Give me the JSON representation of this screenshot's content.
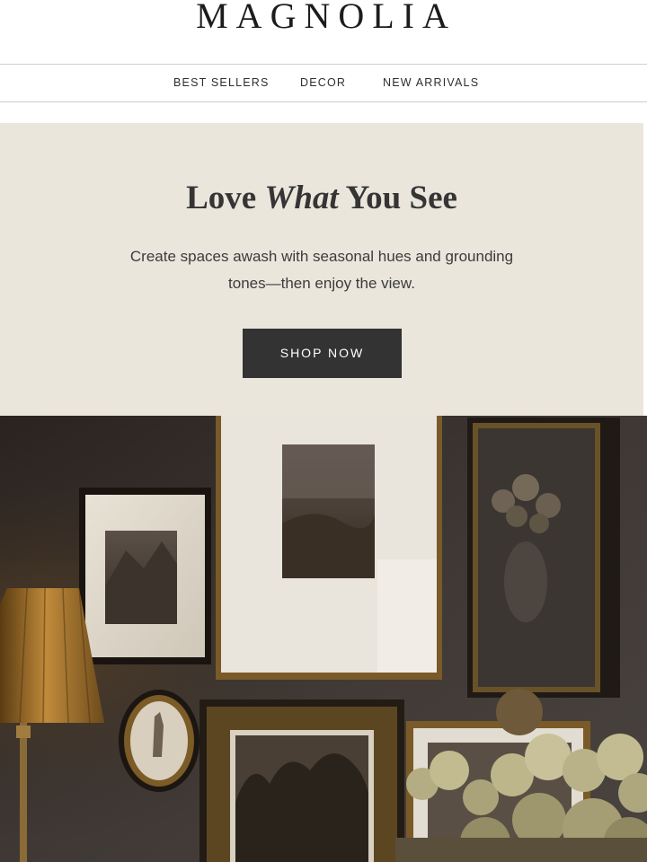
{
  "brand": {
    "name": "MAGNOLIA"
  },
  "nav": {
    "items": [
      {
        "label": "BEST SELLERS"
      },
      {
        "label": "DECOR"
      },
      {
        "label": "NEW ARRIVALS"
      }
    ]
  },
  "hero": {
    "title_pre": "Love ",
    "title_em": "What",
    "title_post": " You See",
    "subtitle_line1": "Create spaces awash with seasonal hues and grounding",
    "subtitle_line2": "tones—then enjoy the view.",
    "cta": "SHOP NOW",
    "bg_color": "#ebe6dc",
    "button_color": "#333333"
  },
  "photo": {
    "subject": "gallery-wall-of-framed-vintage-art"
  }
}
